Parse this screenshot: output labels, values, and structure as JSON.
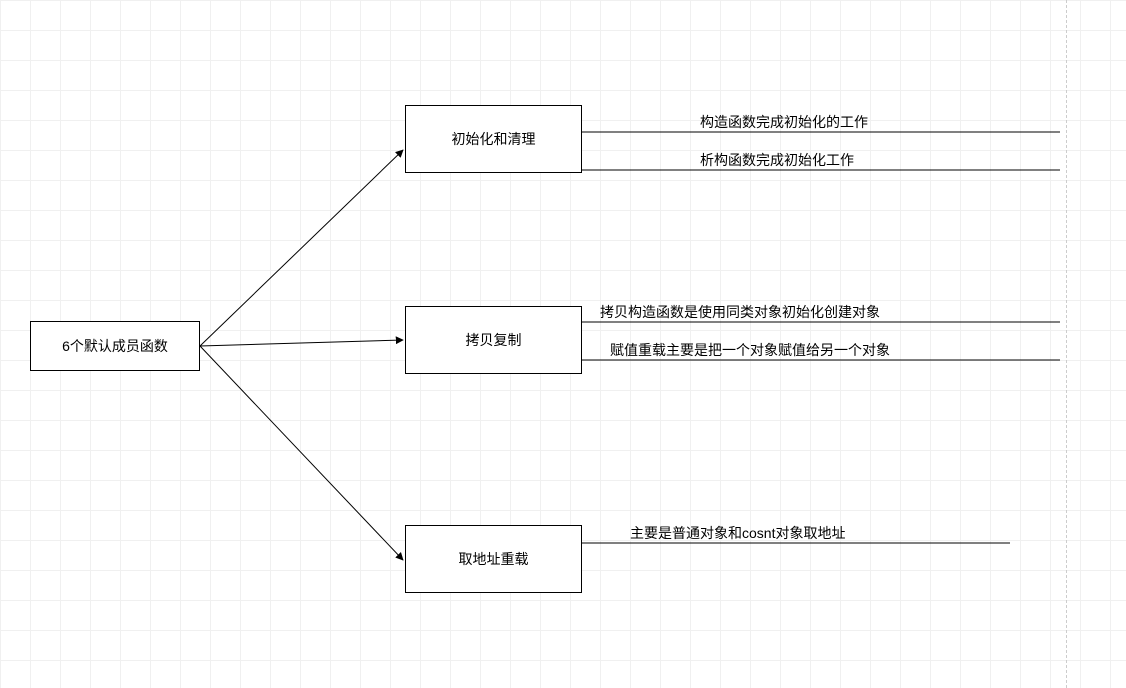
{
  "root": {
    "label": "6个默认成员函数"
  },
  "branches": [
    {
      "label": "初始化和清理",
      "notes": [
        "构造函数完成初始化的工作",
        "析构函数完成初始化工作"
      ]
    },
    {
      "label": "拷贝复制",
      "notes": [
        "拷贝构造函数是使用同类对象初始化创建对象",
        "赋值重载主要是把一个对象赋值给另一个对象"
      ]
    },
    {
      "label": "取地址重载",
      "notes": [
        "主要是普通对象和cosnt对象取地址"
      ]
    }
  ]
}
